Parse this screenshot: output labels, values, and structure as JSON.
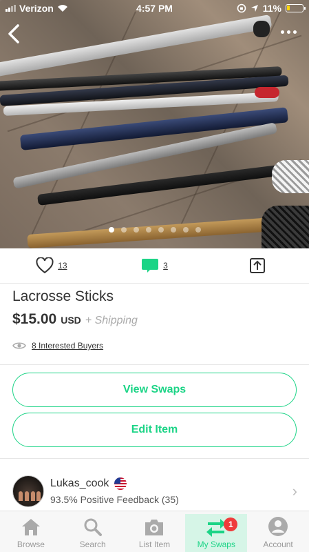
{
  "status_bar": {
    "carrier": "Verizon",
    "time": "4:57 PM",
    "battery": "11%"
  },
  "photo": {
    "dot_count": 8,
    "active_index": 0
  },
  "actions": {
    "likes": "13",
    "comments": "3"
  },
  "item": {
    "title": "Lacrosse Sticks",
    "price": "$15.00",
    "currency": "USD",
    "shipping": "+ Shipping",
    "interested": "8 Interested Buyers"
  },
  "buttons": {
    "view_swaps": "View Swaps",
    "edit_item": "Edit Item"
  },
  "seller": {
    "name": "Lukas_cook",
    "feedback": "93.5% Positive Feedback (35)"
  },
  "tabs": [
    {
      "label": "Browse",
      "icon": "home-icon"
    },
    {
      "label": "Search",
      "icon": "search-icon"
    },
    {
      "label": "List Item",
      "icon": "camera-icon"
    },
    {
      "label": "My Swaps",
      "icon": "swap-arrows-icon",
      "badge": "1",
      "active": true
    },
    {
      "label": "Account",
      "icon": "account-icon"
    }
  ],
  "colors": {
    "accent": "#1bd486",
    "badge": "#ef3b3b",
    "battery": "#ffd60a"
  }
}
